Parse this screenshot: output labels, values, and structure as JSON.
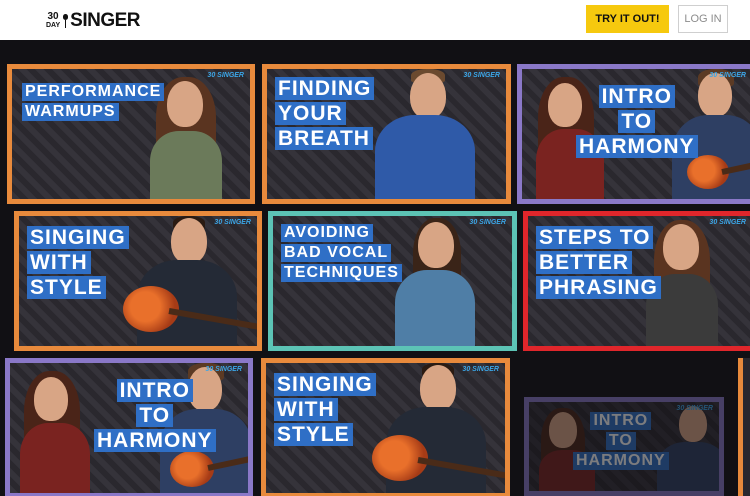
{
  "header": {
    "logo_top": "30",
    "logo_bottom": "DAY",
    "logo_word": "SINGER",
    "try_label": "TRY IT OUT!",
    "login_label": "LOG IN"
  },
  "cards": [
    {
      "title": [
        "PERFORMANCE",
        "WARMUPS"
      ],
      "brand": "30 SINGER"
    },
    {
      "title": [
        "FINDING",
        "YOUR",
        "BREATH"
      ],
      "brand": "30 SINGER"
    },
    {
      "title": [
        "INTRO",
        "TO",
        "HARMONY"
      ],
      "brand": "30 SINGER"
    },
    {
      "title": [
        "SINGING",
        "WITH",
        "STYLE"
      ],
      "brand": "30 SINGER"
    },
    {
      "title": [
        "AVOIDING",
        "BAD VOCAL",
        "TECHNIQUES"
      ],
      "brand": "30 SINGER"
    },
    {
      "title": [
        "STEPS TO",
        "BETTER",
        "PHRASING"
      ],
      "brand": "30 SINGER"
    },
    {
      "title": [
        "INTRO",
        "TO",
        "HARMONY"
      ],
      "brand": "30 SINGER"
    },
    {
      "title": [
        "SINGING",
        "WITH",
        "STYLE"
      ],
      "brand": "30 SINGER"
    },
    {
      "title": [
        "INTRO",
        "TO",
        "HARMONY"
      ],
      "brand": "30 SINGER"
    }
  ],
  "colors": {
    "accent": "#f6c90e",
    "title_bg": "#2f6fc6",
    "border_orange": "#e88a3c",
    "border_purple": "#8a78c8",
    "border_teal": "#5cc3b5",
    "border_red": "#e0262b"
  }
}
